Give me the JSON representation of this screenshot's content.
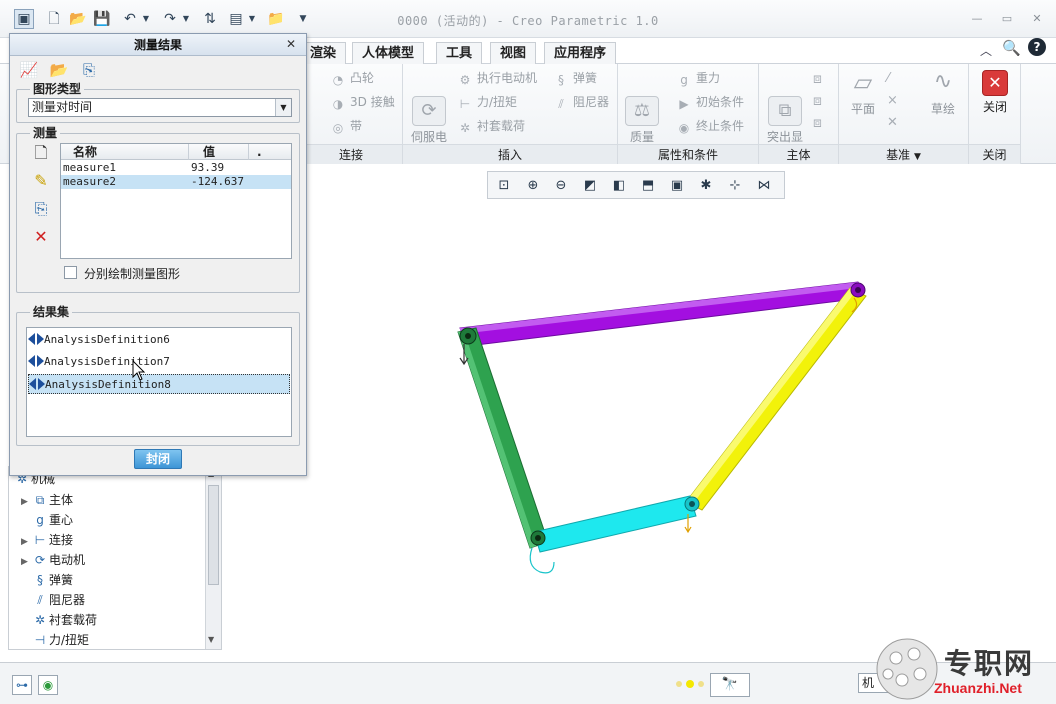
{
  "window": {
    "title": "0000 (活动的) - Creo Parametric 1.0",
    "minimize": "—",
    "restore": "▭",
    "close": "✕"
  },
  "ribbon": {
    "tabs": [
      "渲染",
      "人体模型",
      "工具",
      "视图",
      "应用程序"
    ],
    "groups": {
      "connection": {
        "label": "连接",
        "items": [
          "凸轮",
          "3D 接触",
          "带"
        ]
      },
      "insert": {
        "label": "插入",
        "servo": "伺服电\n动机",
        "items": [
          "执行电动机",
          "弹簧",
          "力/扭矩",
          "阻尼器",
          "衬套载荷"
        ]
      },
      "props": {
        "label": "属性和条件",
        "mass": "质量\n属性",
        "items": [
          "重力",
          "初始条件",
          "终止条件"
        ]
      },
      "body": {
        "label": "主体",
        "highlight": "突出显\n示主体"
      },
      "datum": {
        "label": "基准",
        "plane": "平面",
        "sketch": "草绘"
      },
      "close": {
        "label": "关闭",
        "button": "关闭"
      }
    }
  },
  "dialog": {
    "title": "测量结果",
    "graph_type_label": "图形类型",
    "graph_type_value": "测量对时间",
    "measures_label": "测量",
    "table_headers": [
      "名称",
      "值",
      "."
    ],
    "measures": [
      {
        "name": "measure1",
        "value": "93.39"
      },
      {
        "name": "measure2",
        "value": "-124.637"
      }
    ],
    "separate_plot_label": "分别绘制测量图形",
    "result_sets_label": "结果集",
    "result_sets": [
      "AnalysisDefinition6",
      "AnalysisDefinition7",
      "AnalysisDefinition8"
    ],
    "close_button": "封闭"
  },
  "tree": {
    "root": "机械",
    "items": [
      "主体",
      "重心",
      "连接",
      "电动机",
      "弹簧",
      "阻尼器",
      "衬套载荷",
      "力/扭矩"
    ]
  },
  "status": {
    "filter_text": "机"
  },
  "watermark": {
    "cn": "专职网",
    "en": "Zhuanzhi.Net"
  },
  "colors": {
    "link_top": "#a30fe0",
    "link_left": "#2ea24f",
    "link_right": "#f2f20a",
    "link_bottom": "#1ee8ee",
    "selection": "#c6e2f5",
    "close_icon": "#d93a3a"
  }
}
